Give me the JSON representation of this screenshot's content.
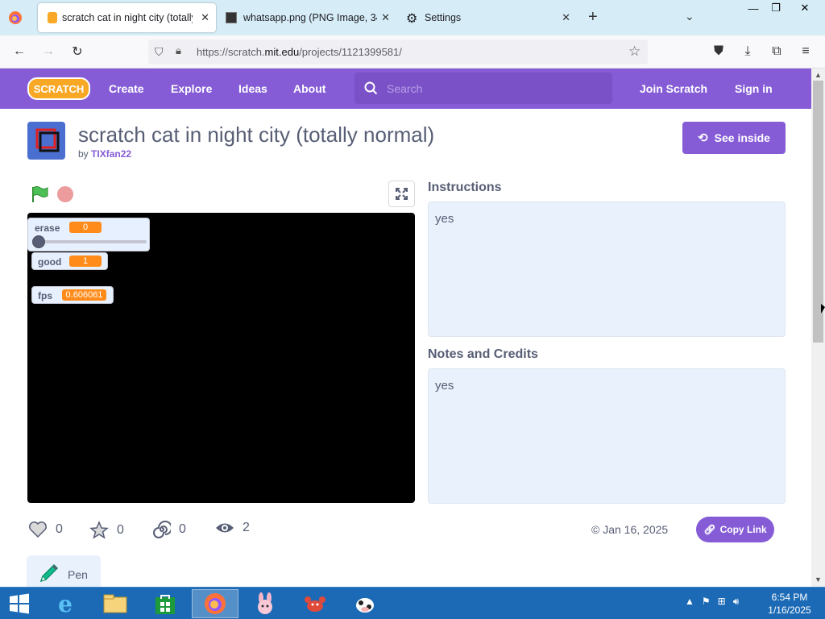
{
  "browser": {
    "tabs": [
      {
        "title": "scratch cat in night city (totally",
        "active": true
      },
      {
        "title": "whatsapp.png (PNG Image, 34",
        "active": false
      },
      {
        "title": "Settings",
        "active": false
      }
    ],
    "url_prefix": "https://scratch.",
    "url_domain": "mit.edu",
    "url_path": "/projects/1121399581/"
  },
  "header": {
    "logo_text": "SCRATCH",
    "nav": [
      "Create",
      "Explore",
      "Ideas",
      "About"
    ],
    "search_placeholder": "Search",
    "join": "Join Scratch",
    "signin": "Sign in"
  },
  "project": {
    "title": "scratch cat in night city (totally normal)",
    "by_label": "by",
    "author": "TIXfan22",
    "see_inside": "See inside"
  },
  "stage": {
    "monitors": [
      {
        "label": "erase",
        "value": "0",
        "slider": true,
        "slider_level": 0
      },
      {
        "label": "good",
        "value": "1"
      },
      {
        "label": "fps",
        "value": "0.606061"
      }
    ]
  },
  "info": {
    "instructions_heading": "Instructions",
    "instructions_text": "yes",
    "notes_heading": "Notes and Credits",
    "notes_text": "yes"
  },
  "stats": {
    "loves": "0",
    "favorites": "0",
    "remixes": "0",
    "views": "2",
    "date": "Jan 16, 2025",
    "copy_link": "Copy Link"
  },
  "extensions": [
    {
      "name": "Pen"
    }
  ],
  "taskbar": {
    "time": "6:54 PM",
    "date": "1/16/2025"
  },
  "colors": {
    "brand": "#855cd6",
    "monitor_value": "#ff8c1a",
    "taskbar": "#1c6ab5"
  }
}
